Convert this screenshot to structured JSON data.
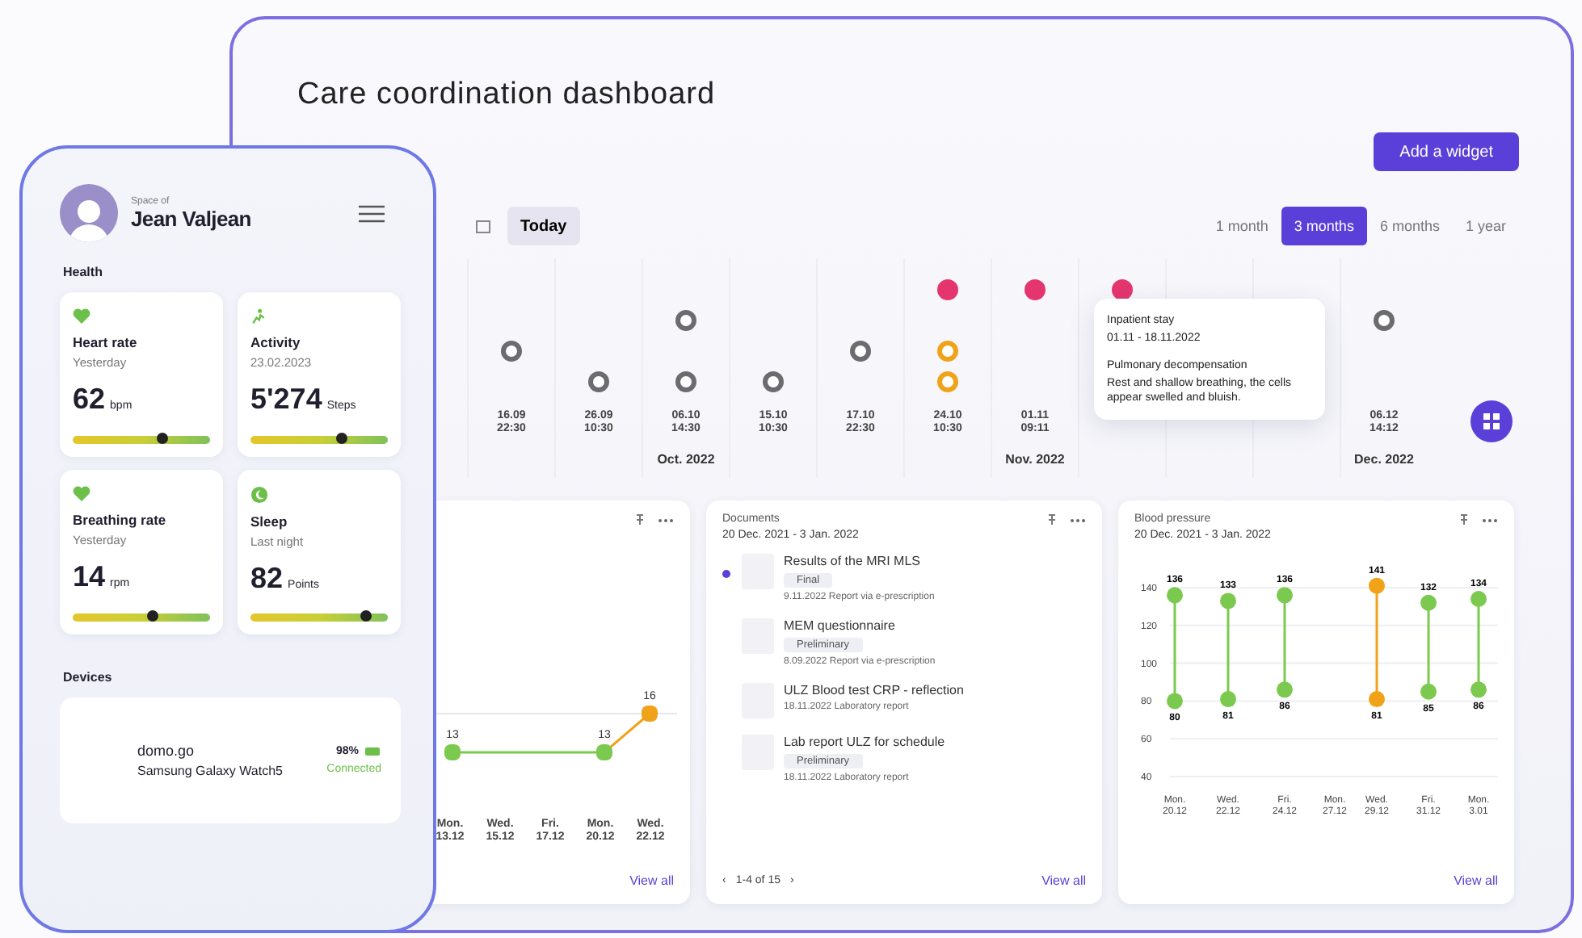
{
  "dashboard": {
    "title": "Care coordination dashboard",
    "add_button": "Add a widget",
    "today_button": "Today",
    "ranges": [
      {
        "label": "1 month",
        "selected": false
      },
      {
        "label": "3 months",
        "selected": true
      },
      {
        "label": "6 months",
        "selected": false
      },
      {
        "label": "1 year",
        "selected": false
      }
    ],
    "timeline": {
      "columns": [
        {
          "date": "16.09",
          "time": "22:30",
          "events": [
            {
              "kind": "consultation",
              "color": "#6b6b70"
            }
          ]
        },
        {
          "date": "26.09",
          "time": "10:30",
          "events": [
            {
              "kind": "examination",
              "color": "#6b6b70"
            }
          ]
        },
        {
          "date": "06.10",
          "time": "14:30",
          "month": "Oct. 2022",
          "events": [
            {
              "kind": "report",
              "color": "#6b6b70"
            },
            {
              "kind": "examination",
              "color": "#6b6b70"
            }
          ]
        },
        {
          "date": "15.10",
          "time": "10:30",
          "events": [
            {
              "kind": "examination",
              "color": "#6b6b70"
            }
          ]
        },
        {
          "date": "17.10",
          "time": "22:30",
          "events": [
            {
              "kind": "consultation",
              "color": "#6b6b70"
            }
          ]
        },
        {
          "date": "24.10",
          "time": "10:30",
          "events": [
            {
              "kind": "hospital",
              "color": "#e5356f"
            },
            {
              "kind": "consultation",
              "color": "#f0a318"
            },
            {
              "kind": "examination",
              "color": "#f0a318"
            }
          ]
        },
        {
          "date": "01.11",
          "time": "09:11",
          "month": "Nov. 2022",
          "events": [
            {
              "kind": "hospital",
              "color": "#e5356f"
            }
          ]
        },
        {
          "events": [
            {
              "kind": "hospital",
              "color": "#e5356f"
            }
          ]
        },
        {},
        {},
        {
          "date": "06.12",
          "time": "14:12",
          "month": "Dec. 2022",
          "events": [
            {
              "kind": "report",
              "color": "#6b6b70"
            }
          ]
        }
      ],
      "tooltip": {
        "title": "Inpatient stay",
        "dates": "01.11 - 18.11.2022",
        "heading": "Pulmonary decompensation",
        "text": "Rest and shallow breathing, the cells appear swelled and bluish."
      }
    },
    "trend_card": {
      "points": [
        {
          "value": "13",
          "color": "#7cc94f"
        },
        {
          "value": "13",
          "color": "#7cc94f"
        },
        {
          "value": "16",
          "color": "#f0a318"
        }
      ],
      "x_labels": [
        "Mon. 13.12",
        "Wed. 15.12",
        "Fri. 17.12",
        "Mon. 20.12",
        "Wed. 22.12"
      ],
      "link": "View all"
    },
    "documents": {
      "title": "Documents",
      "range": "20 Dec. 2021 - 3 Jan. 2022",
      "items": [
        {
          "name": "Results of the MRI MLS",
          "tag": "Final",
          "meta": "9.11.2022 Report via e-prescription",
          "unread": true
        },
        {
          "name": "MEM questionnaire",
          "tag": "Preliminary",
          "meta": "8.09.2022 Report via e-prescription",
          "unread": false
        },
        {
          "name": "ULZ Blood test CRP - reflection",
          "meta": "18.11.2022 Laboratory report",
          "unread": false
        },
        {
          "name": "Lab report ULZ for schedule",
          "tag": "Preliminary",
          "meta": "18.11.2022 Laboratory report",
          "unread": false
        }
      ],
      "prev": "‹",
      "pager": "1-4 of 15",
      "next": "›",
      "link": "View all"
    },
    "blood_pressure": {
      "title": "Blood pressure",
      "range": "20 Dec. 2021 - 3 Jan. 2022",
      "y_labels": [
        "140",
        "120",
        "100",
        "80",
        "60",
        "40"
      ],
      "days": [
        {
          "label": "Mon. 20.12",
          "systolic": "136",
          "diastolic": "80",
          "color": "#7cc94f"
        },
        {
          "label": "Wed. 22.12",
          "systolic": "133",
          "diastolic": "81",
          "color": "#7cc94f"
        },
        {
          "label": "Fri. 24.12",
          "systolic": "136",
          "diastolic": "86",
          "color": "#7cc94f"
        },
        {
          "label": "Mon. 27.12"
        },
        {
          "label": "Wed. 29.12",
          "systolic": "141",
          "diastolic": "81",
          "color": "#f0a318"
        },
        {
          "label": "Fri. 31.12",
          "systolic": "132",
          "diastolic": "85",
          "color": "#7cc94f"
        },
        {
          "label": "Mon. 3.01",
          "systolic": "134",
          "diastolic": "86",
          "color": "#7cc94f"
        }
      ],
      "link": "View all"
    }
  },
  "phone": {
    "caption": "Space of",
    "name": "Jean Valjean",
    "health_label": "Health",
    "metrics": [
      {
        "kind": "heart",
        "title": "Heart rate",
        "when": "Yesterday",
        "value": "62",
        "unit": "bpm",
        "level": 0.65
      },
      {
        "kind": "activity",
        "title": "Activity",
        "when": "23.02.2023",
        "value": "5'274",
        "unit": "Steps",
        "level": 0.66
      },
      {
        "kind": "heart",
        "title": "Breathing rate",
        "when": "Yesterday",
        "value": "14",
        "unit": "rpm",
        "level": 0.58
      },
      {
        "kind": "sleep",
        "title": "Sleep",
        "when": "Last night",
        "value": "82",
        "unit": "Points",
        "level": 0.84
      }
    ],
    "devices_label": "Devices",
    "device": {
      "brand": "domo.go",
      "model": "Samsung Galaxy Watch5",
      "battery": "98%",
      "status": "Connected"
    }
  }
}
